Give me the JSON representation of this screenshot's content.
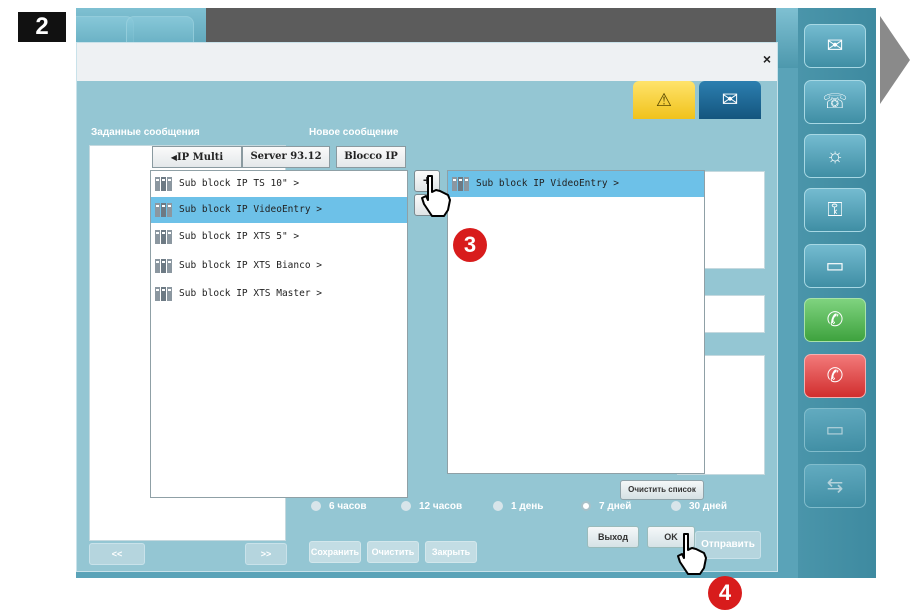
{
  "steps": {
    "top_left": "2",
    "circle_a": "3",
    "circle_b": "4"
  },
  "dialog": {
    "section_left": "Заданные сообщения",
    "section_right": "Новое сообщение",
    "close_glyph": "×",
    "radio_options": [
      {
        "label": "6 часов",
        "selected": false
      },
      {
        "label": "12 часов",
        "selected": false
      },
      {
        "label": "1 день",
        "selected": false
      },
      {
        "label": "7 дней",
        "selected": true
      },
      {
        "label": "30 дней",
        "selected": false
      }
    ],
    "bottom_buttons": {
      "save": "Сохранить",
      "clear": "Очистить",
      "close": "Закрыть"
    },
    "send_button": "Отправить",
    "pager_prev": "<<",
    "pager_next": ">>"
  },
  "picker": {
    "breadcrumb": [
      "IP Multi server",
      "Server 93.12",
      "Blocco IP"
    ],
    "source_list": [
      {
        "label": "Sub block IP TS 10\" >",
        "selected": false
      },
      {
        "label": "Sub block IP VideoEntry >",
        "selected": true
      },
      {
        "label": "Sub block IP XTS 5\" >",
        "selected": false
      },
      {
        "label": "Sub block IP XTS Bianco >",
        "selected": false
      },
      {
        "label": "Sub block IP XTS Master >",
        "selected": false
      }
    ],
    "target_list": [
      {
        "label": "Sub block IP VideoEntry >",
        "selected": true
      }
    ],
    "add_label": "+",
    "remove_label": "−",
    "clear_list_label": "Очистить список",
    "exit_label": "Выход",
    "ok_label": "OK"
  },
  "icons": {
    "tab_warning": "warning-triangle-icon",
    "tab_message": "envelope-icon",
    "rail": [
      "envelope-icon",
      "contacts-icon",
      "light-icon",
      "key-icon",
      "camera-icon",
      "phone-answer-icon",
      "phone-hangup-icon",
      "video-camera-icon",
      "intercom-icon"
    ]
  },
  "colors": {
    "dialog_bg": "#96c7d4",
    "selected_row": "#6dc1e8",
    "warning_tab": "#f0c21b",
    "message_tab": "#14557e",
    "step_marker": "#d81c1c"
  }
}
